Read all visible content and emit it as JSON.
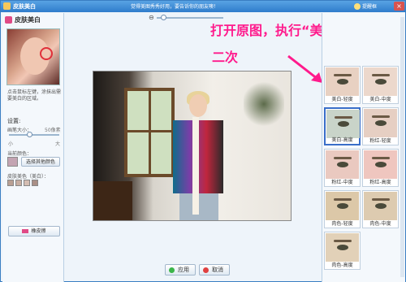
{
  "window": {
    "title": "皮肤美白",
    "notice": "觉得美图秀秀好用，要告诉你的朋友噢！",
    "tip": "提醒框",
    "close_glyph": "×"
  },
  "left_panel": {
    "title": "皮肤美白",
    "hint": "点击鼠标左键，涂抹出需要美白的区域。",
    "settings_label": "设置:",
    "pen_size_label": "画笔大小：",
    "pen_size_value": "50像素",
    "slider_min": "小",
    "slider_max": "大",
    "slider_level": 0.4,
    "current_color_label": "当前颜色：",
    "current_color": "#c3a4b2",
    "pick_color_button": "选择其他颜色",
    "skin_tone_label": "皮肤美色（美白）：",
    "skin_tones": [
      "#b9a093",
      "#c7aea2",
      "#d4bdb2",
      "#a98f86"
    ],
    "eraser_button": "橡皮擦"
  },
  "zoom": {
    "icon": "zoom-icon",
    "level": 0.1
  },
  "annotation": {
    "line1": "打开原图，执行“美白-高度”",
    "line2": "二次",
    "color": "#ff1a8c"
  },
  "effects": [
    {
      "label": "美白-轻度",
      "tone": "#e8d1c2",
      "selected": false
    },
    {
      "label": "美白-中度",
      "tone": "#ecd8cc",
      "selected": false
    },
    {
      "label": "美白-高度",
      "tone": "#c9d4c9",
      "selected": true
    },
    {
      "label": "粉红-轻度",
      "tone": "#e6cfc3",
      "selected": false
    },
    {
      "label": "粉红-中度",
      "tone": "#eac9c0",
      "selected": false
    },
    {
      "label": "粉红-高度",
      "tone": "#efc6bf",
      "selected": false
    },
    {
      "label": "肉色-轻度",
      "tone": "#dcc8a8",
      "selected": false
    },
    {
      "label": "肉色-中度",
      "tone": "#ddcbb0",
      "selected": false
    },
    {
      "label": "肉色-高度",
      "tone": "#e2d1b8",
      "selected": false
    }
  ],
  "buttons": {
    "apply": "应用",
    "cancel": "取消"
  }
}
